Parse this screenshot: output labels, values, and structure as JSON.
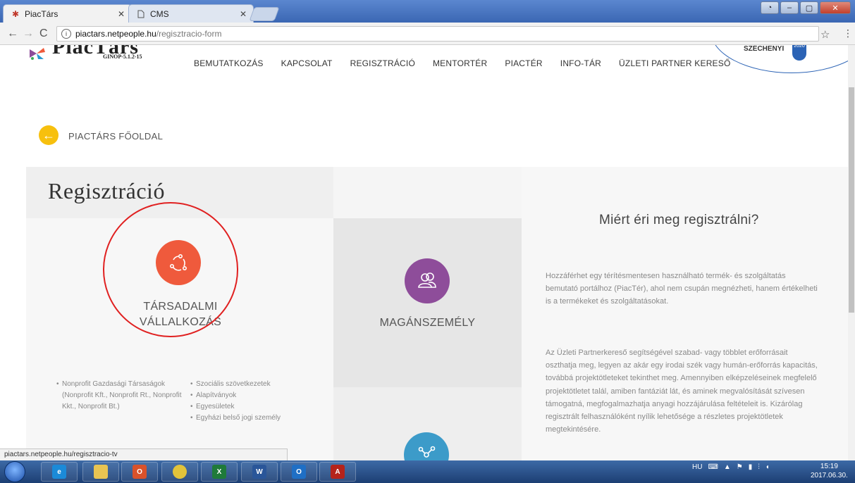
{
  "browser": {
    "tabs": [
      {
        "title": "PiacTárs",
        "active": true
      },
      {
        "title": "CMS",
        "active": false
      }
    ],
    "address": {
      "host": "piactars.netpeople.hu",
      "path": "/regisztracio-form"
    },
    "status_url": "piactars.netpeople.hu/regisztracio-tv",
    "icons": {
      "back": "back-arrow-icon",
      "forward": "forward-arrow-icon",
      "reload": "reload-icon",
      "info": "info-icon",
      "star": "star-icon",
      "menu": "menu-dots-icon"
    }
  },
  "site": {
    "logo_text": "PiacTárs",
    "logo_sub": "GINOP-5.1.2-15",
    "nav": [
      "BEMUTATKOZÁS",
      "KAPCSOLAT",
      "REGISZTRÁCIÓ",
      "MENTORTÉR",
      "PIACTÉR",
      "INFO-TÁR",
      "ÜZLETI PARTNER KERESŐ"
    ],
    "partner_badge": "SZÉCHENYI",
    "partner_badge_year": "2020",
    "back_link": "PIACTÁRS FŐOLDAL"
  },
  "registration": {
    "title": "Regisztráció",
    "cards": [
      {
        "label_line1": "TÁRSADALMI",
        "label_line2": "VÁLLALKOZÁS",
        "color": "#ef5a3c",
        "icon": "recycle-circle-icon"
      },
      {
        "label": "MAGÁNSZEMÉLY",
        "color": "#8e4d9a",
        "icon": "people-icon"
      },
      {
        "color": "#3c9bc9",
        "icon": "network-icon"
      }
    ],
    "list_left": [
      "Nonprofit Gazdasági Társaságok (Nonprofit Kft., Nonprofit Rt., Nonprofit Kkt., Nonprofit Bt.)"
    ],
    "list_right": [
      "Szociális szövetkezetek",
      "Alapítványok",
      "Egyesületek",
      "Egyházi belső jogi személy"
    ]
  },
  "why": {
    "title": "Miért éri meg regisztrálni?",
    "p1": "Hozzáférhet egy térítésmentesen használható termék- és szolgáltatás bemutató portálhoz (PiacTér), ahol nem csupán megnézheti, hanem értékelheti is a termékeket és szolgáltatásokat.",
    "p2": "Az Üzleti Partnerkereső segítségével szabad- vagy többlet erőforrásait oszthatja meg, legyen az akár egy irodai szék vagy humán-erőforrás kapacitás, továbbá projektötleteket tekinthet meg. Amennyiben elképzeléseinek megfelelő projektötletet talál, amiben fantáziát lát, és aminek megvalósítását szívesen támogatná, megfogalmazhatja anyagi hozzájárulása feltételeit is. Kizárólag regisztrált felhasználóként nyílik lehetősége a részletes projektötletek megtekintésére."
  },
  "taskbar": {
    "apps": [
      "Internet Explorer",
      "Explorer",
      "Outlook",
      "Chrome",
      "Excel",
      "Word",
      "Outlook",
      "Acrobat"
    ],
    "tray_lang": "HU",
    "time": "15:19",
    "date": "2017.06.30."
  },
  "colors": {
    "accent_yellow": "#f7c00e",
    "annotation_red": "#e02020",
    "partner_blue": "#2b63b5"
  }
}
